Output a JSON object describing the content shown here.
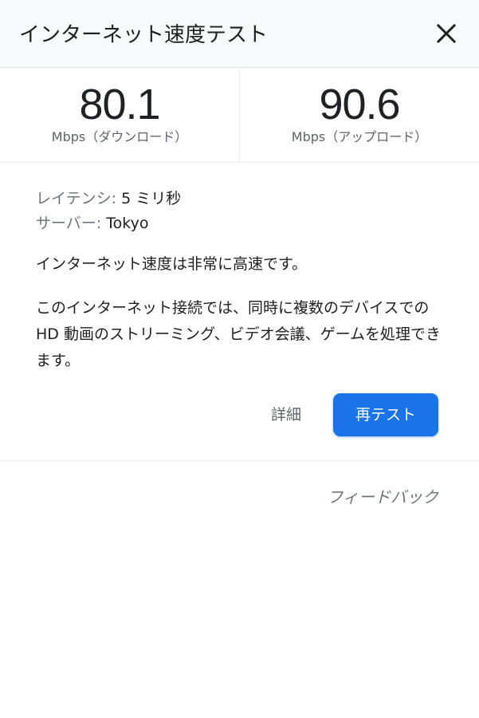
{
  "header": {
    "title": "インターネット速度テスト",
    "close_icon": "close-icon"
  },
  "speeds": {
    "download": {
      "value": "80.1",
      "unit": "Mbps（ダウンロード）"
    },
    "upload": {
      "value": "90.6",
      "unit": "Mbps（アップロード）"
    }
  },
  "info": {
    "latency_label": "レイテンシ:",
    "latency_value": "5 ミリ秒",
    "server_label": "サーバー:",
    "server_value": "Tokyo"
  },
  "summary": "インターネット速度は非常に高速です。",
  "description": "このインターネット接続では、同時に複数のデバイスでの HD 動画のストリーミング、ビデオ会議、ゲームを処理できます。",
  "actions": {
    "details_label": "詳細",
    "retest_label": "再テスト"
  },
  "footer": {
    "feedback_label": "フィードバック"
  },
  "colors": {
    "accent": "#1a73e8",
    "header_background": "#f8f9fa",
    "secondary_text": "#5f6368"
  }
}
